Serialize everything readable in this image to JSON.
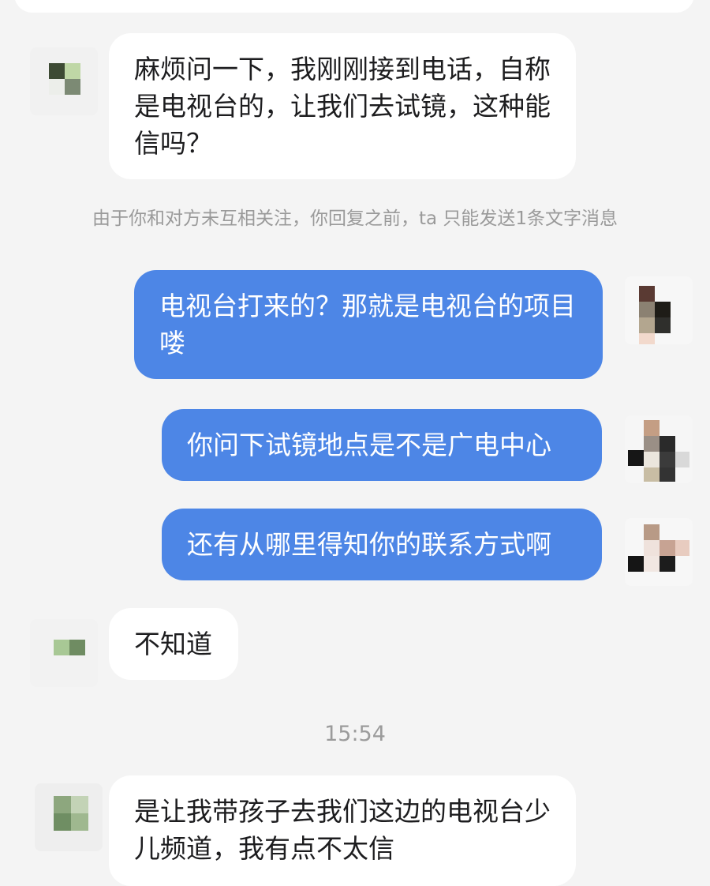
{
  "messages": [
    {
      "direction": "in",
      "text": "麻烦问一下，我刚刚接到电话，自称是电视台的，让我们去试镜，这种能信吗？"
    },
    {
      "direction": "out",
      "text": "电视台打来的？那就是电视台的项目喽"
    },
    {
      "direction": "out",
      "text": "你问下试镜地点是不是广电中心"
    },
    {
      "direction": "out",
      "text": "还有从哪里得知你的联系方式啊"
    },
    {
      "direction": "in",
      "text": "不知道"
    },
    {
      "direction": "in",
      "text": "是让我带孩子去我们这边的电视台少儿频道，我有点不太信"
    }
  ],
  "system_note": "由于你和对方未互相关注，你回复之前，ta 只能发送1条文字消息",
  "timestamp": "15:54",
  "colors": {
    "background": "#f4f4f4",
    "incoming_bubble": "#ffffff",
    "outgoing_bubble": "#4d86e6",
    "system_text": "#9a9a9a"
  },
  "avatars": {
    "contact": "pixelated-avatar",
    "self": "pixelated-avatar"
  }
}
